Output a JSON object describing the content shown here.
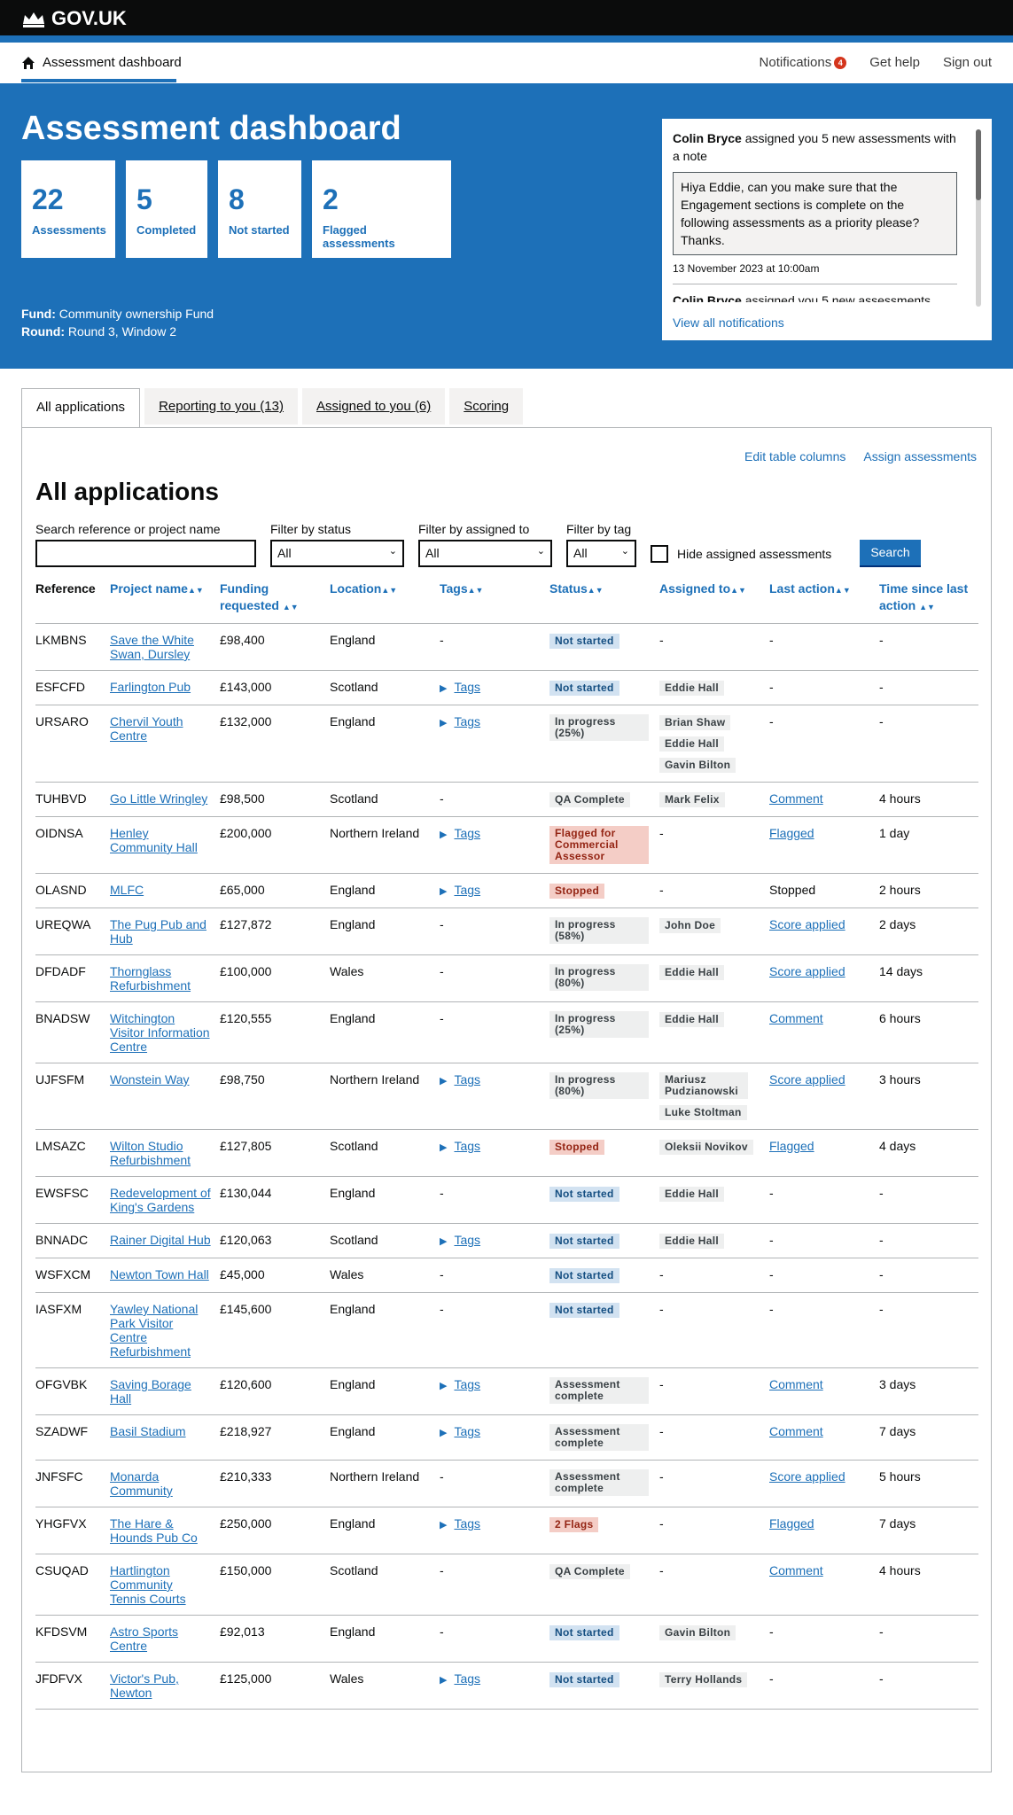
{
  "header": {
    "logo": "GOV.UK"
  },
  "service_nav": {
    "home_label": "Assessment dashboard",
    "notifications": "Notifications",
    "notifications_count": "4",
    "help": "Get help",
    "signout": "Sign out"
  },
  "hero": {
    "title": "Assessment dashboard",
    "stats": [
      {
        "num": "22",
        "label": "Assessments"
      },
      {
        "num": "5",
        "label": "Completed"
      },
      {
        "num": "8",
        "label": "Not started"
      },
      {
        "num": "2",
        "label": "Flagged assessments"
      }
    ],
    "fund_label": "Fund:",
    "fund_value": "Community ownership Fund",
    "round_label": "Round:",
    "round_value": "Round 3, Window 2"
  },
  "notification": {
    "sender": "Colin Bryce",
    "text": "assigned you 5 new assessments with a note",
    "note": "Hiya Eddie, can you make sure that the Engagement sections is complete on the following assessments as a priority please? Thanks.",
    "date": "13 November 2023 at 10:00am",
    "next": "assigned you 5 new assessments",
    "view_all": "View all notifications"
  },
  "tabs": [
    "All applications",
    "Reporting to you (13)",
    "Assigned to you (6)",
    "Scoring"
  ],
  "panel": {
    "edit_columns": "Edit table columns",
    "assign": "Assign assessments",
    "title": "All applications",
    "search_label": "Search reference or project name",
    "status_label": "Filter by status",
    "assigned_label": "Filter by assigned to",
    "tag_label": "Filter by tag",
    "all": "All",
    "hide_assigned": "Hide assigned assessments",
    "search_button": "Search"
  },
  "table": {
    "headers": [
      "Reference",
      "Project name",
      "Funding requested",
      "Location",
      "Tags",
      "Status",
      "Assigned to",
      "Last action",
      "Time since last action"
    ],
    "rows": [
      {
        "ref": "LKMBNS",
        "name": "Save the White Swan, Dursley",
        "fund": "£98,400",
        "loc": "England",
        "tags": "-",
        "status": "Not started",
        "sc": "blue",
        "assigned": [],
        "last": "-",
        "last_link": false,
        "time": "-"
      },
      {
        "ref": "ESFCFD",
        "name": "Farlington Pub",
        "fund": "£143,000",
        "loc": "Scotland",
        "tags": "Tags",
        "status": "Not started",
        "sc": "blue",
        "assigned": [
          "Eddie Hall"
        ],
        "last": "-",
        "last_link": false,
        "time": "-"
      },
      {
        "ref": "URSARO",
        "name": "Chervil Youth Centre",
        "fund": "£132,000",
        "loc": "England",
        "tags": "Tags",
        "status": "In progress (25%)",
        "sc": "grey",
        "assigned": [
          "Brian Shaw",
          "Eddie Hall",
          "Gavin Bilton"
        ],
        "last": "-",
        "last_link": false,
        "time": "-"
      },
      {
        "ref": "TUHBVD",
        "name": "Go Little Wringley",
        "fund": "£98,500",
        "loc": "Scotland",
        "tags": "-",
        "status": "QA Complete",
        "sc": "grey",
        "assigned": [
          "Mark Felix"
        ],
        "last": "Comment",
        "last_link": true,
        "time": "4 hours"
      },
      {
        "ref": "OIDNSA",
        "name": "Henley Community Hall",
        "fund": "£200,000",
        "loc": "Northern Ireland",
        "tags": "Tags",
        "status": "Flagged for Commercial Assessor",
        "sc": "red",
        "assigned": [],
        "last": "Flagged",
        "last_link": true,
        "time": "1 day"
      },
      {
        "ref": "OLASND",
        "name": "MLFC",
        "fund": "£65,000",
        "loc": "England",
        "tags": "Tags",
        "status": "Stopped",
        "sc": "red",
        "assigned": [],
        "last": "Stopped",
        "last_link": false,
        "time": "2 hours"
      },
      {
        "ref": "UREQWA",
        "name": "The Pug Pub and Hub",
        "fund": "£127,872",
        "loc": "England",
        "tags": "-",
        "status": "In progress (58%)",
        "sc": "grey",
        "assigned": [
          "John Doe"
        ],
        "last": "Score applied",
        "last_link": true,
        "time": "2 days"
      },
      {
        "ref": "DFDADF",
        "name": "Thornglass Refurbishment",
        "fund": "£100,000",
        "loc": "Wales",
        "tags": "-",
        "status": "In progress (80%)",
        "sc": "grey",
        "assigned": [
          "Eddie Hall"
        ],
        "last": "Score applied",
        "last_link": true,
        "time": "14 days"
      },
      {
        "ref": "BNADSW",
        "name": "Witchington Visitor Information Centre",
        "fund": "£120,555",
        "loc": "England",
        "tags": "-",
        "status": "In progress (25%)",
        "sc": "grey",
        "assigned": [
          "Eddie Hall"
        ],
        "last": "Comment",
        "last_link": true,
        "time": "6 hours"
      },
      {
        "ref": "UJFSFM",
        "name": "Wonstein Way",
        "fund": "£98,750",
        "loc": "Northern Ireland",
        "tags": "Tags",
        "status": "In progress (80%)",
        "sc": "grey",
        "assigned": [
          "Mariusz Pudzianowski",
          "Luke Stoltman"
        ],
        "last": "Score applied",
        "last_link": true,
        "time": "3 hours"
      },
      {
        "ref": "LMSAZC",
        "name": "Wilton Studio Refurbishment",
        "fund": "£127,805",
        "loc": "Scotland",
        "tags": "Tags",
        "status": "Stopped",
        "sc": "red",
        "assigned": [
          "Oleksii Novikov"
        ],
        "last": "Flagged",
        "last_link": true,
        "time": "4 days"
      },
      {
        "ref": "EWSFSC",
        "name": "Redevelopment of King's Gardens",
        "fund": "£130,044",
        "loc": "England",
        "tags": "-",
        "status": "Not started",
        "sc": "blue",
        "assigned": [
          "Eddie Hall"
        ],
        "last": "-",
        "last_link": false,
        "time": "-"
      },
      {
        "ref": "BNNADC",
        "name": "Rainer Digital Hub",
        "fund": "£120,063",
        "loc": "Scotland",
        "tags": "Tags",
        "status": "Not started",
        "sc": "blue",
        "assigned": [
          "Eddie Hall"
        ],
        "last": "-",
        "last_link": false,
        "time": "-"
      },
      {
        "ref": "WSFXCM",
        "name": "Newton Town Hall",
        "fund": "£45,000",
        "loc": "Wales",
        "tags": "-",
        "status": "Not started",
        "sc": "blue",
        "assigned": [],
        "last": "-",
        "last_link": false,
        "time": "-"
      },
      {
        "ref": "IASFXM",
        "name": "Yawley National Park Visitor Centre Refurbishment",
        "fund": "£145,600",
        "loc": "England",
        "tags": "-",
        "status": "Not started",
        "sc": "blue",
        "assigned": [],
        "last": "-",
        "last_link": false,
        "time": "-"
      },
      {
        "ref": "OFGVBK",
        "name": "Saving Borage Hall",
        "fund": "£120,600",
        "loc": "England",
        "tags": "Tags",
        "status": "Assessment complete",
        "sc": "grey",
        "assigned": [],
        "last": "Comment",
        "last_link": true,
        "time": "3 days"
      },
      {
        "ref": "SZADWF",
        "name": "Basil Stadium",
        "fund": "£218,927",
        "loc": "England",
        "tags": "Tags",
        "status": "Assessment complete",
        "sc": "grey",
        "assigned": [],
        "last": "Comment",
        "last_link": true,
        "time": "7 days"
      },
      {
        "ref": "JNFSFC",
        "name": "Monarda Community",
        "fund": "£210,333",
        "loc": "Northern Ireland",
        "tags": "-",
        "status": "Assessment complete",
        "sc": "grey",
        "assigned": [],
        "last": "Score applied",
        "last_link": true,
        "time": "5 hours"
      },
      {
        "ref": "YHGFVX",
        "name": "The Hare & Hounds Pub Co",
        "fund": "£250,000",
        "loc": "England",
        "tags": "Tags",
        "status": "2 Flags",
        "sc": "red",
        "assigned": [],
        "last": "Flagged",
        "last_link": true,
        "time": "7 days"
      },
      {
        "ref": "CSUQAD",
        "name": "Hartlington Community Tennis Courts",
        "fund": "£150,000",
        "loc": "Scotland",
        "tags": "-",
        "status": "QA Complete",
        "sc": "grey",
        "assigned": [],
        "last": "Comment",
        "last_link": true,
        "time": "4 hours"
      },
      {
        "ref": "KFDSVM",
        "name": "Astro Sports Centre",
        "fund": "£92,013",
        "loc": "England",
        "tags": "-",
        "status": "Not started",
        "sc": "blue",
        "assigned": [
          "Gavin Bilton"
        ],
        "last": "-",
        "last_link": false,
        "time": "-"
      },
      {
        "ref": "JFDFVX",
        "name": "Victor's Pub, Newton",
        "fund": "£125,000",
        "loc": "Wales",
        "tags": "Tags",
        "status": "Not started",
        "sc": "blue",
        "assigned": [
          "Terry Hollands"
        ],
        "last": "-",
        "last_link": false,
        "time": "-"
      }
    ]
  }
}
